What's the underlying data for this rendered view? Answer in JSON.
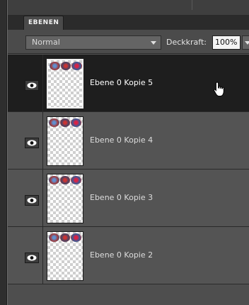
{
  "panel": {
    "tab_label": "EBENEN"
  },
  "controls": {
    "blend_mode": "Normal",
    "opacity_label": "Deckkraft:",
    "opacity_value": "100%"
  },
  "layers": [
    {
      "name": "Ebene 0 Kopie 5",
      "selected": true,
      "visible": true
    },
    {
      "name": "Ebene 0 Kopie 4",
      "selected": false,
      "visible": true
    },
    {
      "name": "Ebene 0 Kopie 3",
      "selected": false,
      "visible": true
    },
    {
      "name": "Ebene 0 Kopie 2",
      "selected": false,
      "visible": true
    }
  ],
  "icons": {
    "visibility": "eye-icon",
    "cursor": "hand-pointer-icon",
    "dropdown": "chevron-down-icon"
  },
  "colors": {
    "panel_bg": "#555555",
    "selected_row_bg": "#1e1e1e",
    "tabbar_bg": "#2b2b2b"
  }
}
